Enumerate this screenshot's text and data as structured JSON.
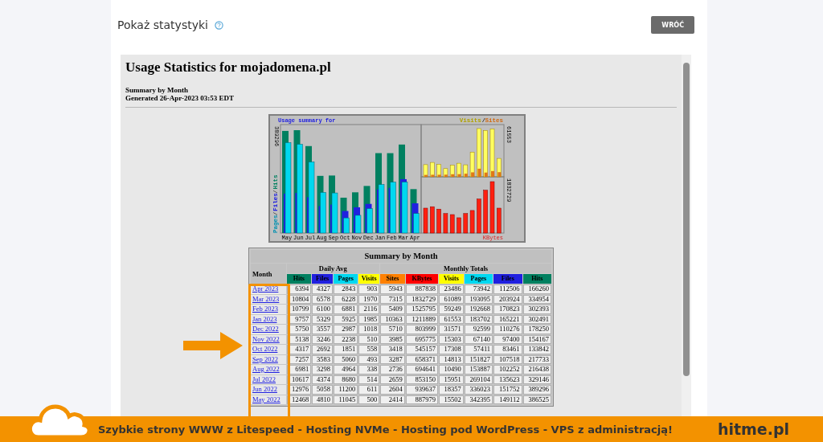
{
  "header": {
    "title": "Pokaż statystyki",
    "button": "WRÓĆ"
  },
  "report": {
    "title": "Usage Statistics for mojadomena.pl",
    "subtitle": "Summary by Month",
    "generated": "Generated 26-Apr-2023 03:53 EDT"
  },
  "chart": {
    "title": "Usage summary for",
    "separator": "/",
    "left_legend": [
      {
        "label": "Pages",
        "color": "#0090b0"
      },
      {
        "label": "Files",
        "color": "#2020e0"
      },
      {
        "label": "Hits",
        "color": "#008060"
      }
    ],
    "right_legend": [
      {
        "label": "Visits",
        "color": "#b0a000"
      },
      {
        "label": "Sites",
        "color": "#d06810"
      }
    ],
    "bottom_label": "KBytes",
    "max_hits": "389296",
    "max_visits": "61553",
    "max_kbytes": "1832729",
    "months": [
      "May",
      "Jun",
      "Jul",
      "Aug",
      "Sep",
      "Oct",
      "Nov",
      "Dec",
      "Jan",
      "Feb",
      "Mar",
      "Apr"
    ]
  },
  "table": {
    "caption": "Summary by Month",
    "month_header": "Month",
    "groups": [
      {
        "label": "Daily Avg"
      },
      {
        "label": "Monthly Totals"
      }
    ],
    "columns": [
      {
        "label": "Hits",
        "color": "#008060"
      },
      {
        "label": "Files",
        "color": "#2020e0"
      },
      {
        "label": "Pages",
        "color": "#00d8f0"
      },
      {
        "label": "Visits",
        "color": "#ffff00"
      },
      {
        "label": "Sites",
        "color": "#ff8000"
      },
      {
        "label": "KBytes",
        "color": "#ff0000"
      },
      {
        "label": "Visits",
        "color": "#ffff00"
      },
      {
        "label": "Pages",
        "color": "#00d8f0"
      },
      {
        "label": "Files",
        "color": "#2020e0"
      },
      {
        "label": "Hits",
        "color": "#008060"
      }
    ],
    "rows": [
      {
        "month": "Apr 2023",
        "values": [
          "6394",
          "4327",
          "2843",
          "903",
          "5943",
          "887838",
          "23486",
          "73942",
          "112506",
          "166260"
        ]
      },
      {
        "month": "Mar 2023",
        "values": [
          "10804",
          "6578",
          "6228",
          "1970",
          "7315",
          "1832729",
          "61089",
          "193095",
          "203924",
          "334954"
        ]
      },
      {
        "month": "Feb 2023",
        "values": [
          "10799",
          "6100",
          "6881",
          "2116",
          "5409",
          "1525795",
          "59249",
          "192668",
          "170823",
          "302393"
        ]
      },
      {
        "month": "Jan 2023",
        "values": [
          "9757",
          "5329",
          "5925",
          "1985",
          "10363",
          "1211889",
          "61553",
          "183702",
          "165221",
          "302491"
        ]
      },
      {
        "month": "Dec 2022",
        "values": [
          "5750",
          "3557",
          "2987",
          "1018",
          "5710",
          "803999",
          "31571",
          "92599",
          "110276",
          "178250"
        ]
      },
      {
        "month": "Nov 2022",
        "values": [
          "5138",
          "3246",
          "2238",
          "510",
          "3985",
          "695775",
          "15303",
          "67140",
          "97400",
          "154167"
        ]
      },
      {
        "month": "Oct 2022",
        "values": [
          "4317",
          "2692",
          "1851",
          "558",
          "3418",
          "545157",
          "17308",
          "57411",
          "83461",
          "133842"
        ]
      },
      {
        "month": "Sep 2022",
        "values": [
          "7257",
          "3583",
          "5060",
          "493",
          "3287",
          "658371",
          "14813",
          "151827",
          "107518",
          "217733"
        ]
      },
      {
        "month": "Aug 2022",
        "values": [
          "6981",
          "3298",
          "4964",
          "338",
          "2736",
          "694641",
          "10490",
          "153887",
          "102252",
          "216438"
        ]
      },
      {
        "month": "Jul 2022",
        "values": [
          "10617",
          "4374",
          "8680",
          "514",
          "2659",
          "853150",
          "15951",
          "269104",
          "135623",
          "329146"
        ]
      },
      {
        "month": "Jun 2022",
        "values": [
          "12976",
          "5058",
          "11200",
          "611",
          "2604",
          "939637",
          "18357",
          "336023",
          "151752",
          "389296"
        ]
      },
      {
        "month": "May 2022",
        "values": [
          "12468",
          "4810",
          "11045",
          "500",
          "2414",
          "887979",
          "15502",
          "342395",
          "149112",
          "386525"
        ]
      }
    ]
  },
  "banner": {
    "text": "Szybkie strony WWW z Litespeed - Hosting  NVMe - Hosting pod WordPress - VPS z administracją!",
    "brand": "hitme.pl"
  }
}
